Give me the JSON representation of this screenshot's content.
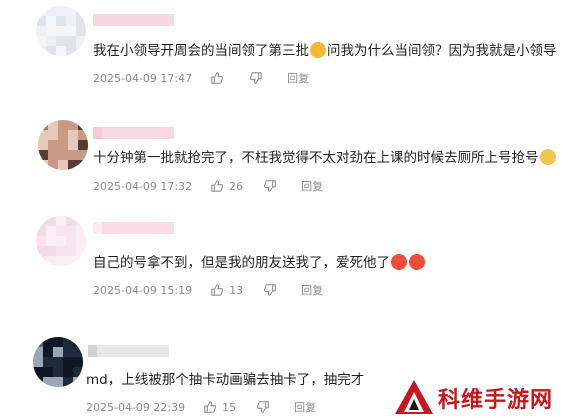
{
  "comments": [
    {
      "text_before": "我在小领导开周会的当间领了第三批",
      "text_after": "问我为什么当间领？因为我就是小领导",
      "emoji": "smirk-cat-emoji",
      "date": "2025-04-09 17:47",
      "likes": "",
      "reply": "回复"
    },
    {
      "text_before": "十分钟第一批就抢完了，不枉我觉得不太对劲在上课的时候去厕所上号抢号",
      "text_after": "",
      "emoji": "tired-face-emoji",
      "date": "2025-04-09 17:32",
      "likes": "26",
      "reply": "回复"
    },
    {
      "text_before": "自己的号拿不到，但是我的朋友送我了，爱死他了",
      "text_after": "",
      "emoji": "hearts-face-emoji",
      "date": "2025-04-09 15:19",
      "likes": "13",
      "reply": "回复"
    },
    {
      "text_before": "md，上线被那个抽卡动画骗去抽卡了，抽完才",
      "text_after": "",
      "emoji": "",
      "date": "2025-04-09 22:39",
      "likes": "15",
      "reply": "回复"
    }
  ],
  "watermark": {
    "text": "科维手游网"
  },
  "colors": {
    "watermark": "#c8161d",
    "meta": "#8a8a8a",
    "background": "#ffffff"
  }
}
